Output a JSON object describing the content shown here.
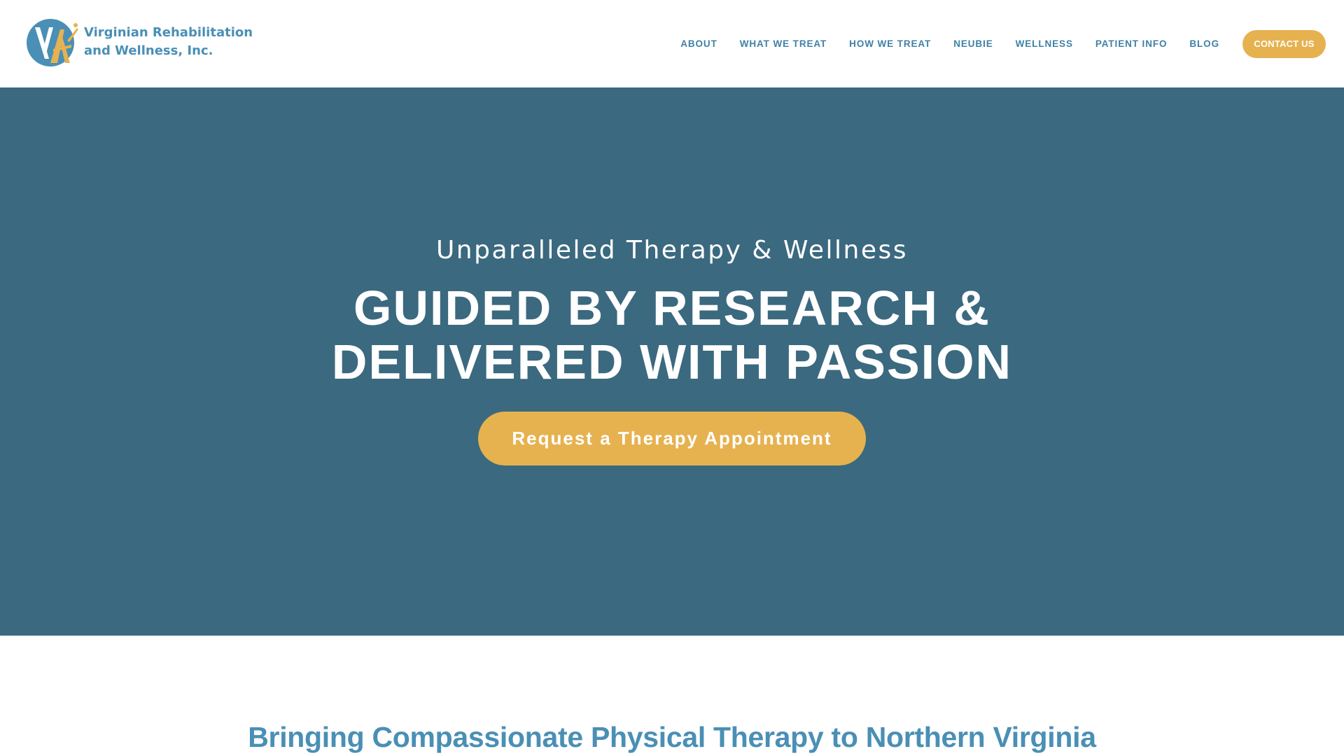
{
  "header": {
    "logo": {
      "line1": "Virginian Rehabilitation",
      "line2": "and Wellness, Inc.",
      "mark_letters": "VA",
      "colors": {
        "circle": "#4a8fb5",
        "accent": "#e6b250"
      }
    },
    "nav": [
      {
        "label": "ABOUT"
      },
      {
        "label": "WHAT WE TREAT"
      },
      {
        "label": "HOW WE TREAT"
      },
      {
        "label": "NEUBIE"
      },
      {
        "label": "WELLNESS"
      },
      {
        "label": "PATIENT INFO"
      },
      {
        "label": "BLOG"
      }
    ],
    "contact_label": "CONTACT US"
  },
  "hero": {
    "kicker": "Unparalleled Therapy & Wellness",
    "headline_line1": "GUIDED BY RESEARCH &",
    "headline_line2": "DELIVERED WITH PASSION",
    "cta_label": "Request a Therapy Appointment"
  },
  "intro": {
    "heading": "Bringing Compassionate Physical Therapy to Northern Virginia"
  },
  "colors": {
    "hero_background": "#3b697f",
    "accent": "#e6b250",
    "brand_blue": "#4a8fb5",
    "nav_text": "#3f81a6"
  }
}
